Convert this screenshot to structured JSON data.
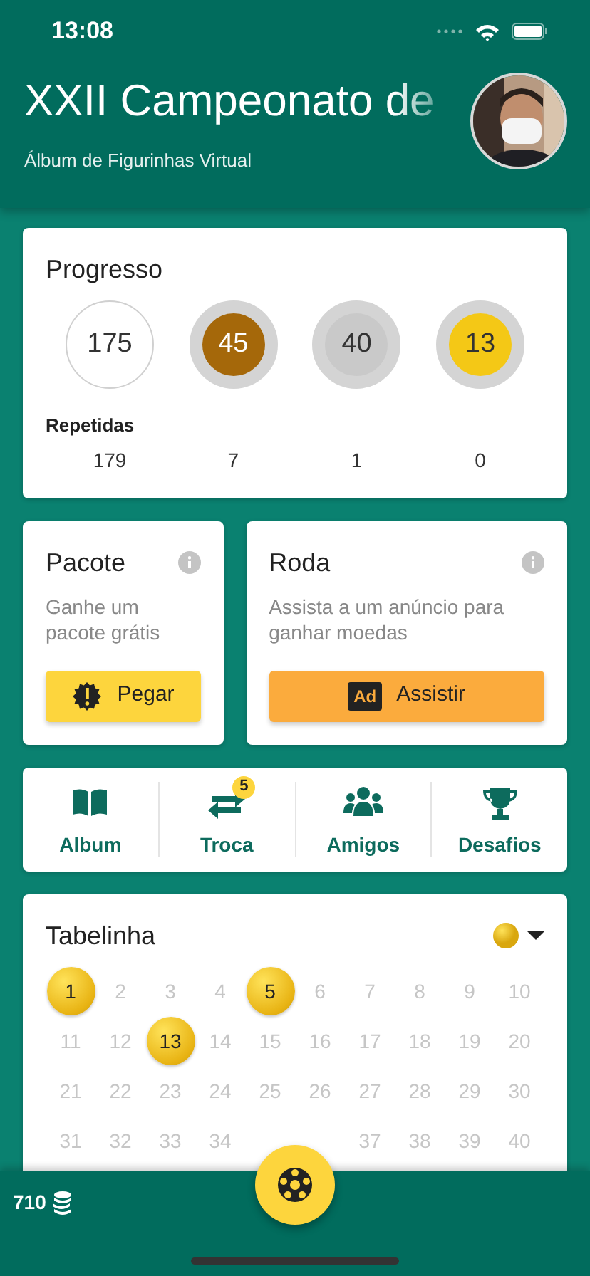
{
  "status_bar": {
    "time": "13:08"
  },
  "header": {
    "title": "XXII Campeonato de",
    "subtitle": "Álbum de Figurinhas Virtual"
  },
  "progress": {
    "title": "Progresso",
    "rings": [
      {
        "value": "175",
        "kind": "outline",
        "color": "#ffffff"
      },
      {
        "value": "45",
        "kind": "medal",
        "color": "#a5680a"
      },
      {
        "value": "40",
        "kind": "medal",
        "color": "#c9c9c9"
      },
      {
        "value": "13",
        "kind": "medal",
        "color": "#f4c816"
      }
    ],
    "repeated_label": "Repetidas",
    "repeated": [
      "179",
      "7",
      "1",
      "0"
    ]
  },
  "actions": [
    {
      "title": "Pacote",
      "description": "Ganhe um pacote grátis",
      "button": "Pegar",
      "kind": "badge"
    },
    {
      "title": "Roda",
      "description": "Assista a um anúncio para ganhar moedas",
      "button": "Assistir",
      "kind": "ad",
      "icon_text": "Ad"
    }
  ],
  "shortcuts": [
    {
      "label": "Album",
      "kind": "book"
    },
    {
      "label": "Troca",
      "kind": "swap",
      "badge": "5"
    },
    {
      "label": "Amigos",
      "kind": "people"
    },
    {
      "label": "Desafios",
      "kind": "trophy"
    }
  ],
  "table": {
    "title": "Tabelinha",
    "numbers": [
      {
        "label": "1",
        "collected": true
      },
      {
        "label": "2",
        "collected": false
      },
      {
        "label": "3",
        "collected": false
      },
      {
        "label": "4",
        "collected": false
      },
      {
        "label": "5",
        "collected": true
      },
      {
        "label": "6",
        "collected": false
      },
      {
        "label": "7",
        "collected": false
      },
      {
        "label": "8",
        "collected": false
      },
      {
        "label": "9",
        "collected": false
      },
      {
        "label": "10",
        "collected": false
      },
      {
        "label": "11",
        "collected": false
      },
      {
        "label": "12",
        "collected": false
      },
      {
        "label": "13",
        "collected": true
      },
      {
        "label": "14",
        "collected": false
      },
      {
        "label": "15",
        "collected": false
      },
      {
        "label": "16",
        "collected": false
      },
      {
        "label": "17",
        "collected": false
      },
      {
        "label": "18",
        "collected": false
      },
      {
        "label": "19",
        "collected": false
      },
      {
        "label": "20",
        "collected": false
      },
      {
        "label": "21",
        "collected": false
      },
      {
        "label": "22",
        "collected": false
      },
      {
        "label": "23",
        "collected": false
      },
      {
        "label": "24",
        "collected": false
      },
      {
        "label": "25",
        "collected": false
      },
      {
        "label": "26",
        "collected": false
      },
      {
        "label": "27",
        "collected": false
      },
      {
        "label": "28",
        "collected": false
      },
      {
        "label": "29",
        "collected": false
      },
      {
        "label": "30",
        "collected": false
      },
      {
        "label": "31",
        "collected": false
      },
      {
        "label": "32",
        "collected": false
      },
      {
        "label": "33",
        "collected": false
      },
      {
        "label": "34",
        "collected": false
      },
      {
        "covered": true
      },
      {
        "covered": true
      },
      {
        "label": "37",
        "collected": false
      },
      {
        "label": "38",
        "collected": false
      },
      {
        "label": "39",
        "collected": false
      },
      {
        "label": "40",
        "collected": false
      }
    ]
  },
  "bottom_bar": {
    "coins": "710"
  }
}
